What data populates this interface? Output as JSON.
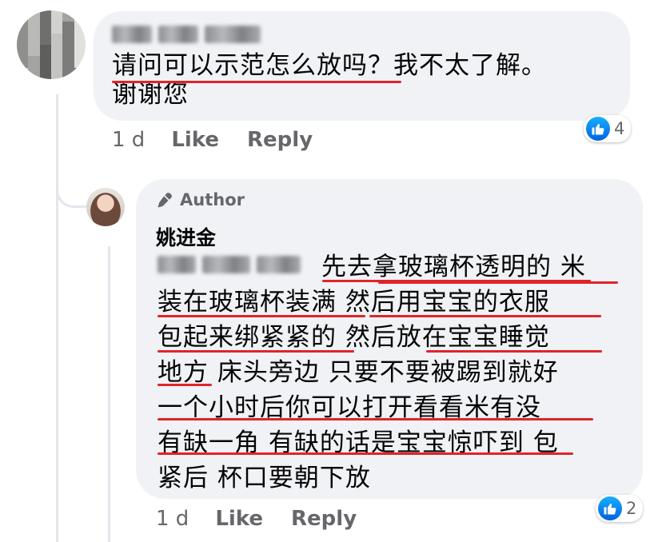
{
  "comment": {
    "text": "请问可以示范怎么放吗？我不太了解。谢谢您",
    "text_line1": "请问可以示范怎么放吗？我不太了解。",
    "text_line2": "谢谢您",
    "time": "1 d",
    "like_label": "Like",
    "reply_label": "Reply",
    "reaction_count": "4",
    "reaction_icon": "like-icon"
  },
  "reply": {
    "badge_label": "Author",
    "badge_icon": "microphone-icon",
    "author_name": "姚进金",
    "lines": [
      "先去拿玻璃杯透明的 米",
      "装在玻璃杯装满 然后用宝宝的衣服",
      "包起来绑紧紧的 然后放在宝宝睡觉",
      "地方 床头旁边 只要不要被踢到就好",
      "一个小时后你可以打开看看米有没",
      "有缺一角 有缺的话是宝宝惊吓到 包",
      "紧后 杯口要朝下放"
    ],
    "time": "1 d",
    "like_label": "Like",
    "reply_label": "Reply",
    "reaction_count": "2",
    "reaction_icon": "like-icon"
  },
  "colors": {
    "bubble": "#f0f2f5",
    "meta_text": "#65676b",
    "underline": "#e0242a",
    "like_blue": "#1877f2"
  }
}
